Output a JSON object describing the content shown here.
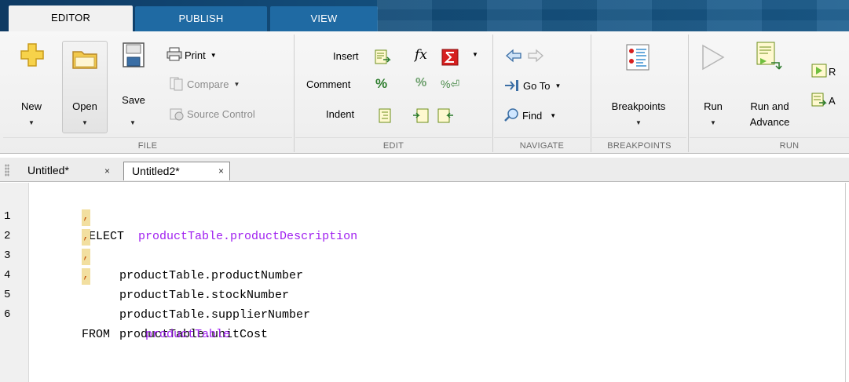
{
  "tabs": [
    {
      "label": "EDITOR"
    },
    {
      "label": "PUBLISH"
    },
    {
      "label": "VIEW"
    }
  ],
  "ribbon": {
    "file": {
      "title": "FILE",
      "new_label": "New",
      "open_label": "Open",
      "save_label": "Save",
      "print_label": "Print",
      "compare_label": "Compare",
      "source_control_label": "Source Control"
    },
    "edit": {
      "title": "EDIT",
      "insert_label": "Insert",
      "comment_label": "Comment",
      "indent_label": "Indent",
      "fx_label": "fx"
    },
    "navigate": {
      "title": "NAVIGATE",
      "goto_label": "Go To",
      "find_label": "Find"
    },
    "breakpoints": {
      "title": "BREAKPOINTS",
      "breakpoints_label": "Breakpoints"
    },
    "run": {
      "title": "RUN",
      "run_label": "Run",
      "run_advance_line1": "Run and",
      "run_advance_line2": "Advance",
      "run_section_partial": "R",
      "advance_partial": "A"
    }
  },
  "documents": [
    {
      "name": "Untitled*"
    },
    {
      "name": "Untitled2*"
    }
  ],
  "editor": {
    "lines": [
      {
        "num": "1",
        "keyword": "SELECT",
        "text": "productTable.productDescription"
      },
      {
        "num": "2",
        "comma": ",",
        "text": "productTable.productNumber"
      },
      {
        "num": "3",
        "comma": ",",
        "text": "productTable.stockNumber"
      },
      {
        "num": "4",
        "comma": ",",
        "text": "productTable.supplierNumber"
      },
      {
        "num": "5",
        "comma": ",",
        "text": "productTable.unitCost"
      },
      {
        "num": "6",
        "keyword": "FROM",
        "text": "productTable"
      }
    ]
  },
  "colors": {
    "tab_active_bg": "#f1f1f1",
    "tab_inactive_bg": "#1f6aa3",
    "header_bg": "#14507e",
    "string_purple": "#a020f0",
    "comma_highlight": "#f2dfa0"
  }
}
